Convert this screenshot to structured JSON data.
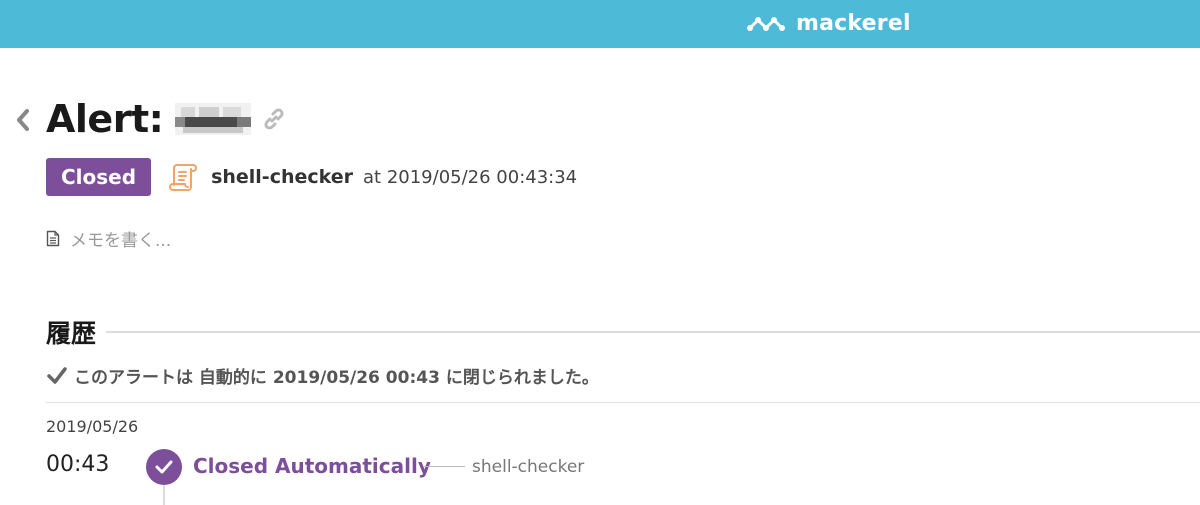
{
  "header": {
    "brand": "mackerel",
    "bar_color": "#4dbbd8"
  },
  "alert": {
    "title": "Alert:",
    "status": "Closed",
    "status_color": "#7d4f9b",
    "monitor_icon": "script-icon",
    "monitor_name": "shell-checker",
    "opened_at": "at 2019/05/26 00:43:34"
  },
  "memo": {
    "icon": "document-icon",
    "placeholder": "メモを書く..."
  },
  "history": {
    "title": "履歴",
    "summary": "このアラートは 自動的に 2019/05/26 00:43 に閉じられました。",
    "events": [
      {
        "date": "2019/05/26",
        "time": "00:43",
        "label": "Closed Automatically",
        "source": "shell-checker"
      }
    ]
  }
}
